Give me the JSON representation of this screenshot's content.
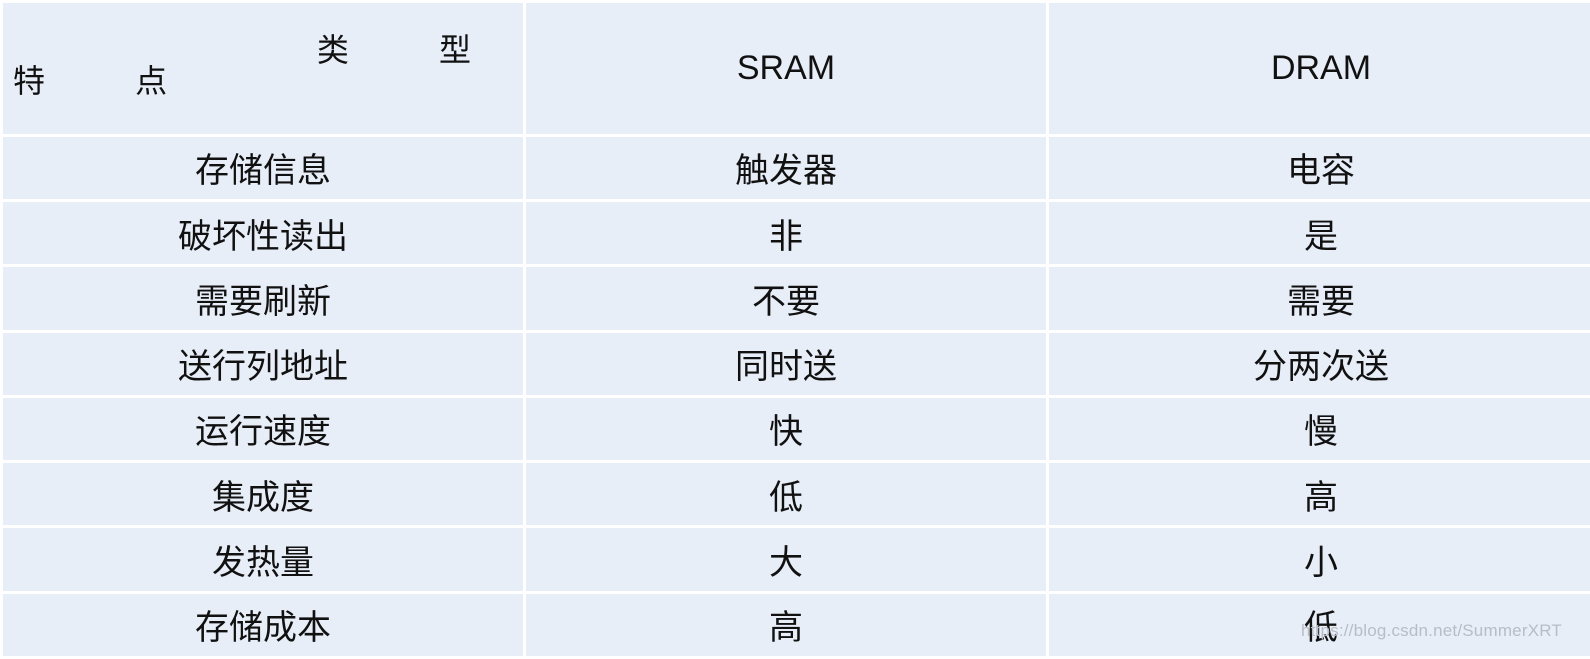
{
  "table": {
    "header": {
      "corner_type": "类 型",
      "corner_feature": "特 点",
      "col_sram": "SRAM",
      "col_dram": "DRAM"
    },
    "rows": [
      {
        "feature": "存储信息",
        "sram": "触发器",
        "dram": "电容"
      },
      {
        "feature": "破坏性读出",
        "sram": "非",
        "dram": "是"
      },
      {
        "feature": "需要刷新",
        "sram": "不要",
        "dram": "需要"
      },
      {
        "feature": "送行列地址",
        "sram": "同时送",
        "dram": "分两次送"
      },
      {
        "feature": "运行速度",
        "sram": "快",
        "dram": "慢"
      },
      {
        "feature": "集成度",
        "sram": "低",
        "dram": "高"
      },
      {
        "feature": "发热量",
        "sram": "大",
        "dram": "小"
      },
      {
        "feature": "存储成本",
        "sram": "高",
        "dram": "低"
      }
    ]
  },
  "watermark": "https://blog.csdn.net/SummerXRT"
}
